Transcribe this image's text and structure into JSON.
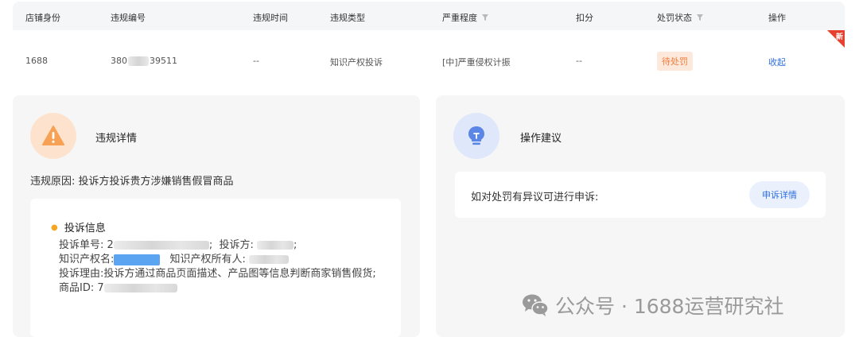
{
  "table": {
    "headers": {
      "shop_identity": "店铺身份",
      "violation_id": "违规编号",
      "violation_time": "违规时间",
      "violation_type": "违规类型",
      "severity": "严重程度",
      "deduction": "扣分",
      "penalty_status": "处罚状态",
      "action": "操作"
    },
    "row": {
      "shop_identity": "1688",
      "violation_id_prefix": "380",
      "violation_id_suffix": "39511",
      "violation_time": "--",
      "violation_type": "知识产权投诉",
      "severity": "[中]严重侵权计振",
      "deduction": "--",
      "penalty_status": "待处罚",
      "action": "收起",
      "new_badge": "新"
    }
  },
  "violation_panel": {
    "title": "违规详情",
    "reason_label": "违规原因:",
    "reason_value": "投诉方投诉贵方涉嫌销售假冒商品",
    "complaint": {
      "heading": "投诉信息",
      "order_no_label": "投诉单号:",
      "order_no_visible": "2",
      "complainant_label": "投诉方:",
      "ip_name_label": "知识产权名:",
      "ip_owner_label": "知识产权所有人:",
      "reason_label": "投诉理由:",
      "reason_value": "投诉方通过商品页面描述、产品图等信息判断商家销售假货;",
      "product_id_label": "商品ID:",
      "product_id_visible": "7"
    }
  },
  "advice_panel": {
    "title": "操作建议",
    "appeal_text": "如对处罚有异议可进行申诉:",
    "appeal_button": "申诉详情"
  },
  "watermark": {
    "text": "公众号 · 1688运营研究社"
  },
  "colors": {
    "status_orange": "#f07b3a",
    "link_blue": "#2f6fe0",
    "new_red": "#e8402f",
    "warning_orange": "#f7a155",
    "bulb_blue": "#5b86e5"
  },
  "icons": {
    "warning": "warning-icon",
    "bulb": "lightbulb-icon",
    "filter": "filter-icon",
    "wechat": "wechat-icon"
  }
}
